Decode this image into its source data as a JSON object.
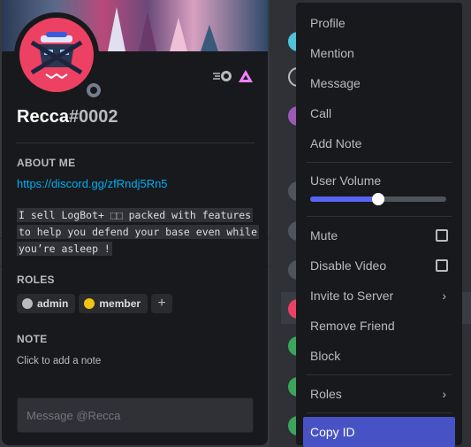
{
  "profile": {
    "username": "Recca",
    "discriminator": "#0002",
    "about_title": "ABOUT ME",
    "link": "https://discord.gg/zfRndj5Rn5",
    "bio_lines": [
      "I sell LogBot+ ⬚⬚ packed with features",
      "to help you defend your base even while",
      "you’re asleep !"
    ],
    "roles_title": "ROLES",
    "roles": [
      {
        "name": "admin",
        "color": "#b9bbbe"
      },
      {
        "name": "member",
        "color": "#f1c40f"
      }
    ],
    "note_title": "NOTE",
    "note_placeholder": "Click to add a note",
    "message_placeholder": "Message @Recca",
    "avatar_color": "#ed4163",
    "status": "offline"
  },
  "menu": {
    "items_top": [
      "Profile",
      "Mention",
      "Message",
      "Call",
      "Add Note"
    ],
    "volume_label": "User Volume",
    "volume_level": 0.5,
    "mute": "Mute",
    "disable_video": "Disable Video",
    "invite": "Invite to Server",
    "remove_friend": "Remove Friend",
    "block": "Block",
    "roles": "Roles",
    "copy_id": "Copy ID",
    "accent": "#4752c4"
  }
}
